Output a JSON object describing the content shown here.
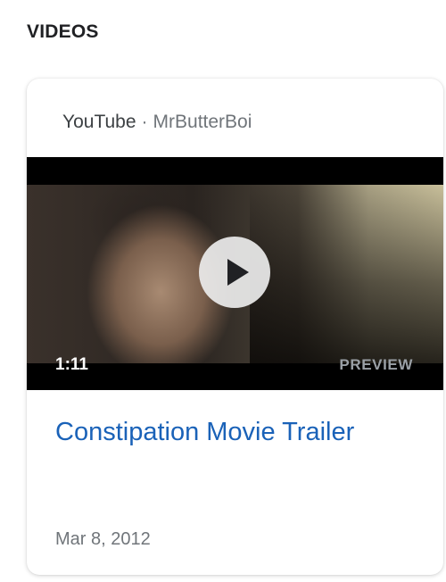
{
  "section": {
    "title": "VIDEOS"
  },
  "card": {
    "source": "YouTube",
    "separator": "·",
    "channel": "MrButterBoi",
    "video": {
      "duration": "1:11",
      "preview_label": "PREVIEW",
      "play_icon": "play-icon"
    },
    "title": "Constipation Movie Trailer",
    "date": "Mar 8, 2012"
  },
  "colors": {
    "title_link": "#1a62b8",
    "meta_text": "#70757a",
    "card_background": "#ffffff"
  }
}
